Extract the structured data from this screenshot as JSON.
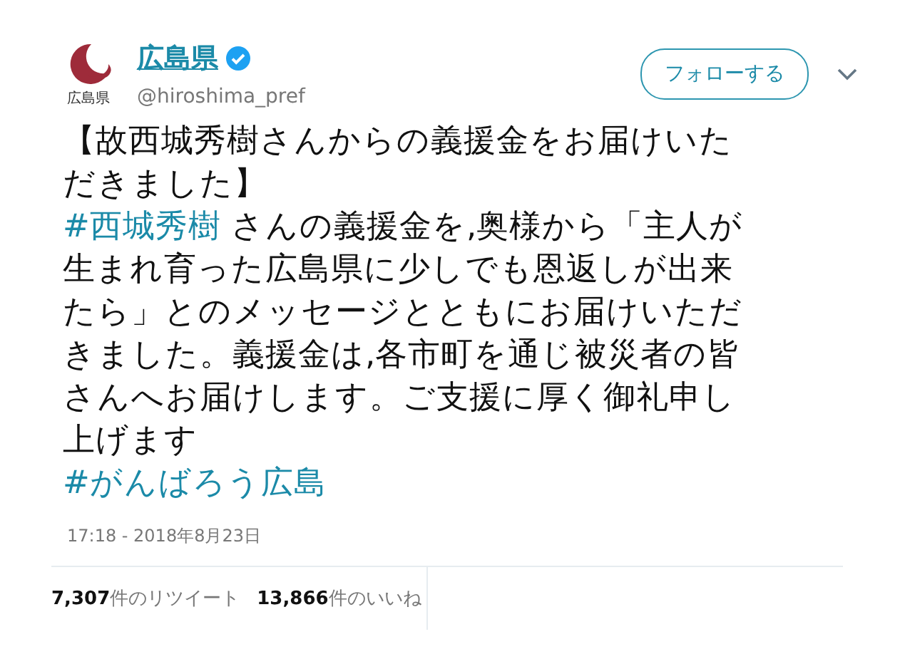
{
  "account": {
    "logo_caption": "広島県",
    "name": "広島県",
    "verified": true,
    "handle": "@hiroshima_pref"
  },
  "follow_button": {
    "label": "フォローする"
  },
  "tweet_lines": [
    [
      {
        "kind": "text",
        "text": "【故西城秀樹さんからの義援金をお届けいた"
      }
    ],
    [
      {
        "kind": "text",
        "text": "だきました】"
      }
    ],
    [
      {
        "kind": "hashtag",
        "text": "#西城秀樹"
      },
      {
        "kind": "text",
        "text": " さんの義援金を,奥様から「主人が"
      }
    ],
    [
      {
        "kind": "text",
        "text": "生まれ育った広島県に少しでも恩返しが出来"
      }
    ],
    [
      {
        "kind": "text",
        "text": "たら」とのメッセージとともにお届けいただ"
      }
    ],
    [
      {
        "kind": "text",
        "text": "きました。義援金は,各市町を通じ被災者の皆"
      }
    ],
    [
      {
        "kind": "text",
        "text": "さんへお届けします。ご支援に厚く御礼申し"
      }
    ],
    [
      {
        "kind": "text",
        "text": "上げます"
      }
    ],
    [
      {
        "kind": "hashtag",
        "text": " #がんばろう広島"
      }
    ]
  ],
  "timestamp": "17:18 - 2018年8月23日",
  "stats": [
    {
      "count": "7,307",
      "label": "件のリツイート"
    },
    {
      "count": "13,866",
      "label": "件のいいね"
    }
  ]
}
